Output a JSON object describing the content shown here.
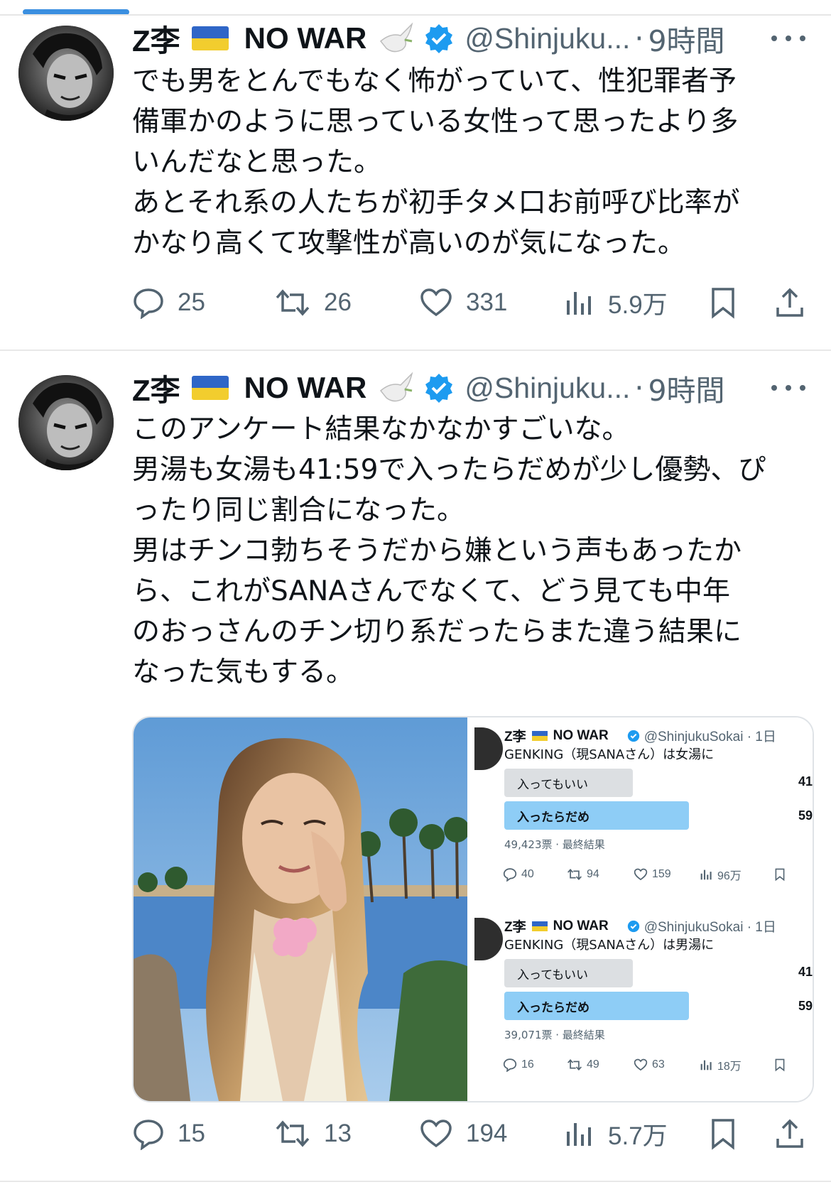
{
  "tweets": [
    {
      "name": "Z李",
      "name2": "NO WAR",
      "handle": "@Shinjuku...",
      "dot": "·",
      "time": "9時間",
      "body": "でも男をとんでもなく怖がっていて、性犯罪者予\n備軍かのように思っている女性って思ったより多\nいんだなと思った。\nあとそれ系の人たちが初手タメ口お前呼び比率が\nかなり高くて攻撃性が高いのが気になった。",
      "replies": "25",
      "retweets": "26",
      "likes": "331",
      "views": "5.9万"
    },
    {
      "name": "Z李",
      "name2": "NO WAR",
      "handle": "@Shinjuku...",
      "dot": "·",
      "time": "9時間",
      "body": "このアンケート結果なかなかすごいな。\n男湯も女湯も41:59で入ったらだめが少し優勢、ぴ\nったり同じ割合になった。\n男はチンコ勃ちそうだから嫌という声もあったか\nら、これがSANAさんでなくて、どう見ても中年\nのおっさんのチン切り系だったらまた違う結果に\nなった気もする。",
      "replies": "15",
      "retweets": "13",
      "likes": "194",
      "views": "5.7万"
    }
  ],
  "polls": [
    {
      "name": "Z李",
      "name2": "NO WAR",
      "handle": "@ShinjukuSokai · 1日",
      "question": "GENKING（現SANAさん）は女湯に",
      "opt1": "入ってもいい",
      "opt1_pct": "41",
      "opt1_value": 41,
      "opt2": "入ったらだめ",
      "opt2_pct": "59",
      "opt2_value": 59,
      "meta": "49,423票 · 最終結果",
      "replies": "40",
      "retweets": "94",
      "likes": "159",
      "views": "96万"
    },
    {
      "name": "Z李",
      "name2": "NO WAR",
      "handle": "@ShinjukuSokai · 1日",
      "question": "GENKING（現SANAさん）は男湯に",
      "opt1": "入ってもいい",
      "opt1_pct": "41",
      "opt1_value": 41,
      "opt2": "入ったらだめ",
      "opt2_pct": "59",
      "opt2_value": 59,
      "meta": "39,071票 · 最終結果",
      "replies": "16",
      "retweets": "49",
      "likes": "63",
      "views": "18万"
    }
  ],
  "colors": {
    "accent": "#1d9bf0",
    "text": "#0f1419",
    "muted": "#536471",
    "poll_winner": "#8ecdf6",
    "poll_other": "#dcdfe2"
  },
  "icons": [
    "reply-icon",
    "retweet-icon",
    "like-icon",
    "views-icon",
    "bookmark-icon",
    "share-icon",
    "verified-icon",
    "more-icon",
    "dove-icon",
    "ukraine-flag-icon"
  ]
}
